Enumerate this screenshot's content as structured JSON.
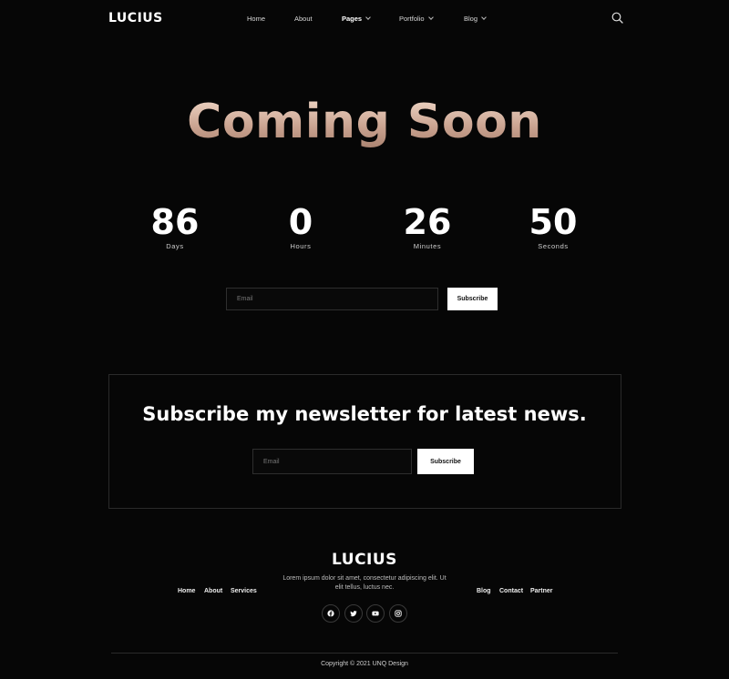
{
  "header": {
    "logo": "LUCIUS",
    "nav": [
      {
        "label": "Home",
        "dropdown": false
      },
      {
        "label": "About",
        "dropdown": false
      },
      {
        "label": "Pages",
        "dropdown": true,
        "active": true
      },
      {
        "label": "Portfolio",
        "dropdown": true
      },
      {
        "label": "Blog",
        "dropdown": true
      }
    ],
    "search_icon": "search-icon"
  },
  "hero": {
    "title": "Coming Soon",
    "countdown": [
      {
        "value": "86",
        "label": "Days"
      },
      {
        "value": "0",
        "label": "Hours"
      },
      {
        "value": "26",
        "label": "Minutes"
      },
      {
        "value": "50",
        "label": "Seconds"
      }
    ],
    "email_placeholder": "Email",
    "subscribe_label": "Subscribe"
  },
  "newsletter": {
    "heading": "Subscribe my newsletter for latest news.",
    "email_placeholder": "Email",
    "subscribe_label": "Subscribe"
  },
  "footer": {
    "logo": "LUCIUS",
    "description": "Lorem ipsum dolor sit amet, consectetur adipiscing elit. Ut elit tellus, luctus nec.",
    "links_left": [
      "Home",
      "About",
      "Services"
    ],
    "links_right": [
      "Blog",
      "Contact",
      "Partner"
    ],
    "social_icons": [
      "facebook-icon",
      "twitter-icon",
      "youtube-icon",
      "instagram-icon"
    ],
    "copyright": "Copyright © 2021 UNQ Design"
  },
  "colors": {
    "background": "#060606",
    "title_gradient_top": "#f3dbcb",
    "title_gradient_bottom": "#a9826f",
    "button_bg": "#ffffff"
  }
}
